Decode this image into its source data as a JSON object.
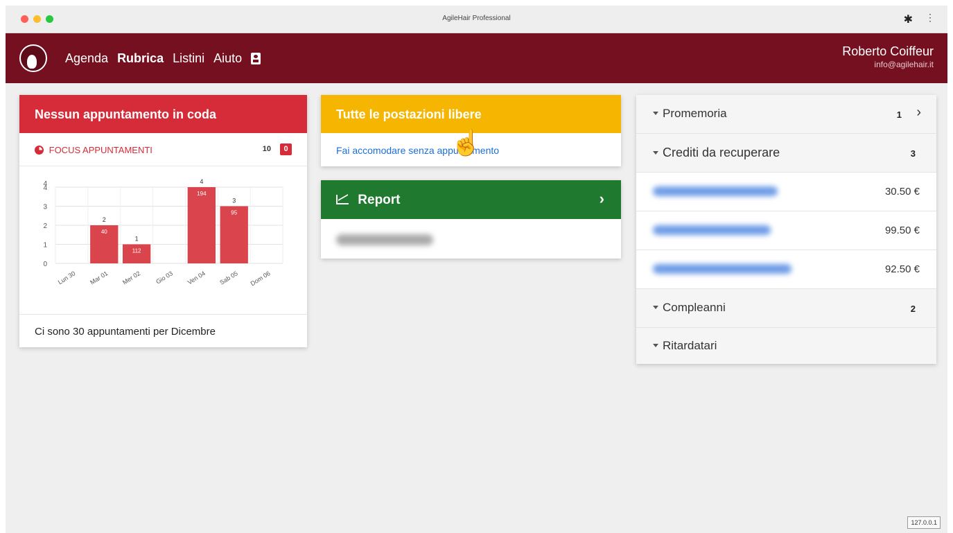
{
  "window": {
    "title": "AgileHair Professional"
  },
  "nav": {
    "items": [
      {
        "label": "Agenda",
        "active": false
      },
      {
        "label": "Rubrica",
        "active": true
      },
      {
        "label": "Listini",
        "active": false
      },
      {
        "label": "Aiuto",
        "active": false
      }
    ]
  },
  "user": {
    "name": "Roberto Coiffeur",
    "email": "info@agilehair.it"
  },
  "queue_card": {
    "title": "Nessun appuntamento in coda",
    "focus_label": "FOCUS APPUNTAMENTI",
    "focus_count": "10",
    "focus_badge": "0",
    "footer": "Ci sono 30 appuntamenti per Dicembre"
  },
  "chart_data": {
    "type": "bar",
    "categories": [
      "Lun 30",
      "Mar 01",
      "Mer 02",
      "Gio 03",
      "Ven 04",
      "Sab 05",
      "Dom 06"
    ],
    "values": [
      0,
      2,
      1,
      0,
      4,
      3,
      0
    ],
    "inner_labels": [
      "",
      "40",
      "112",
      "",
      "194",
      "95",
      ""
    ],
    "ylim": [
      0,
      4
    ],
    "yticks": [
      "0",
      "1",
      "2",
      "3",
      "4",
      "4"
    ],
    "grid": true,
    "bar_color": "#d9444d"
  },
  "stations_card": {
    "title": "Tutte le postazioni libere",
    "link": "Fai accomodare senza appuntamento"
  },
  "report_card": {
    "title": "Report"
  },
  "side_panel": {
    "promemoria": {
      "label": "Promemoria",
      "count": "1"
    },
    "crediti": {
      "label": "Crediti da recuperare",
      "count": "3",
      "items": [
        {
          "amount": "30.50 €"
        },
        {
          "amount": "99.50 €"
        },
        {
          "amount": "92.50 €"
        }
      ]
    },
    "compleanni": {
      "label": "Compleanni",
      "count": "2"
    },
    "ritardatari": {
      "label": "Ritardatari"
    }
  },
  "version": "127.0.0.1",
  "colors": {
    "navbar": "#741020",
    "danger": "#d62b38",
    "warning": "#f5b500",
    "success": "#1f7a2f",
    "link": "#1b6fd6"
  }
}
